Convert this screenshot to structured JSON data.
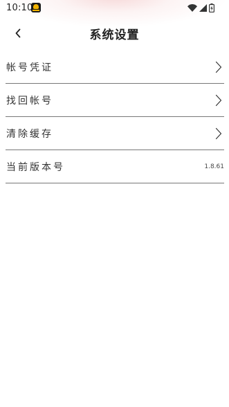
{
  "status_bar": {
    "time": "10:10"
  },
  "header": {
    "title": "系统设置"
  },
  "settings": {
    "items": [
      {
        "label": "帐号凭证",
        "has_chevron": true
      },
      {
        "label": "找回帐号",
        "has_chevron": true
      },
      {
        "label": "清除缓存",
        "has_chevron": true
      },
      {
        "label": "当前版本号",
        "value": "1.8.61"
      }
    ]
  },
  "icons": {
    "back": "chevron-left-icon",
    "row_arrow": "chevron-right-icon",
    "wifi": "wifi-icon",
    "signal": "cell-signal-icon",
    "battery": "battery-charging-icon",
    "app": "app-notification-icon"
  }
}
